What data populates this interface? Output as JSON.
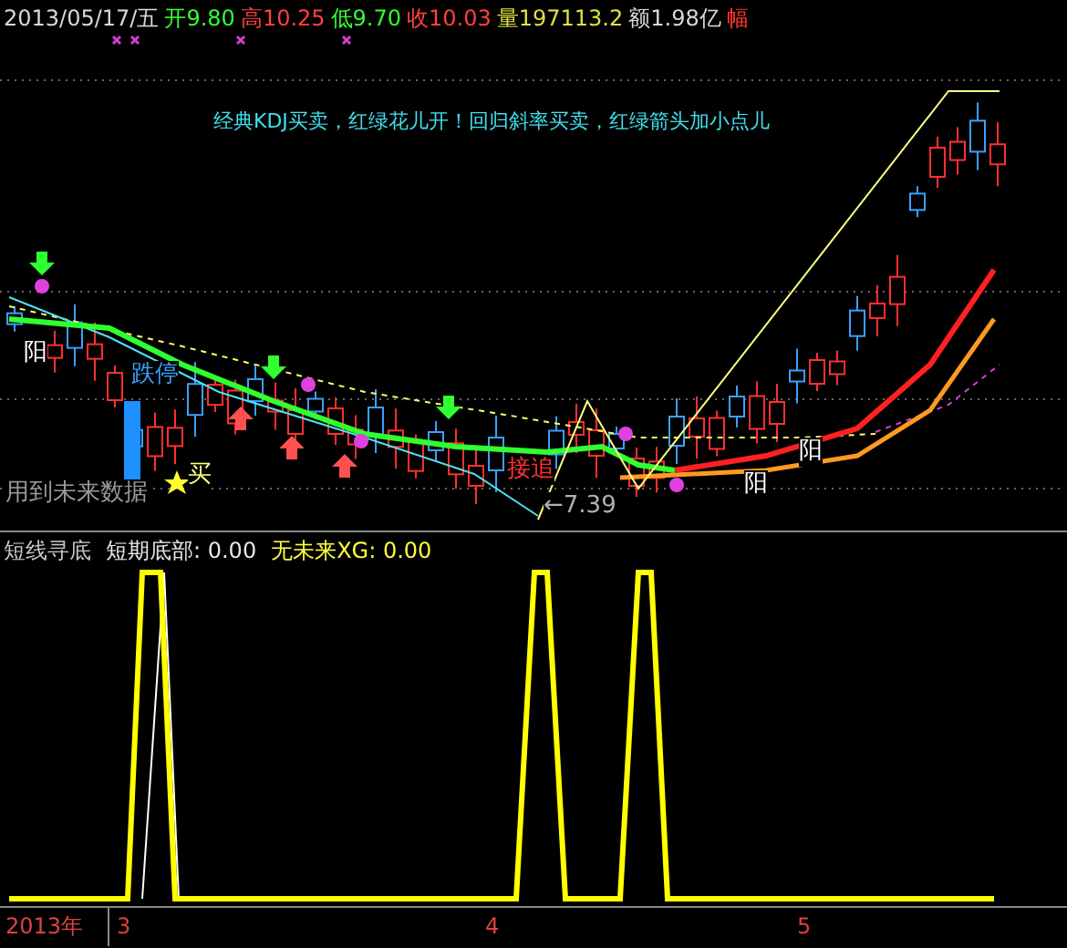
{
  "quote_bar": [
    {
      "text": "2013/05/17/五",
      "color": "#d8d8d8"
    },
    {
      "text": "开9.80",
      "color": "#33ff33"
    },
    {
      "text": "高10.25",
      "color": "#ff4040"
    },
    {
      "text": "低9.70",
      "color": "#33ff33"
    },
    {
      "text": "收10.03",
      "color": "#ff4040"
    },
    {
      "text": "量197113.2",
      "color": "#e0e040"
    },
    {
      "text": "额1.98亿",
      "color": "#d8d8d8"
    },
    {
      "text": "幅",
      "color": "#ff3030"
    }
  ],
  "annotations": [
    {
      "text": "经典KDJ买卖，红绿花儿开！回归斜率买卖，红绿箭头加小点儿",
      "color": "#40e0f0"
    },
    {
      "text": "阳",
      "color": "#ffffff"
    },
    {
      "text": "跌停",
      "color": "#3aa0ff"
    },
    {
      "text": "买",
      "color": "#ffff80"
    },
    {
      "text": "用到未来数据",
      "color": "#9a9a9a"
    },
    {
      "text": "接追",
      "color": "#ff3030"
    },
    {
      "text": "←7.39",
      "color": "#b0b0b0"
    },
    {
      "text": "阳",
      "color": "#ffffff"
    },
    {
      "text": "阳",
      "color": "#ffffff"
    }
  ],
  "indicator": {
    "name": "短线寻底",
    "readings": [
      {
        "text": "短期底部: 0.00",
        "color": "#e8e8e8"
      },
      {
        "text": "无未来XG: 0.00",
        "color": "#ffff40"
      }
    ]
  },
  "time_axis": {
    "year": "2013年",
    "months": [
      "3",
      "4",
      "5"
    ]
  }
}
